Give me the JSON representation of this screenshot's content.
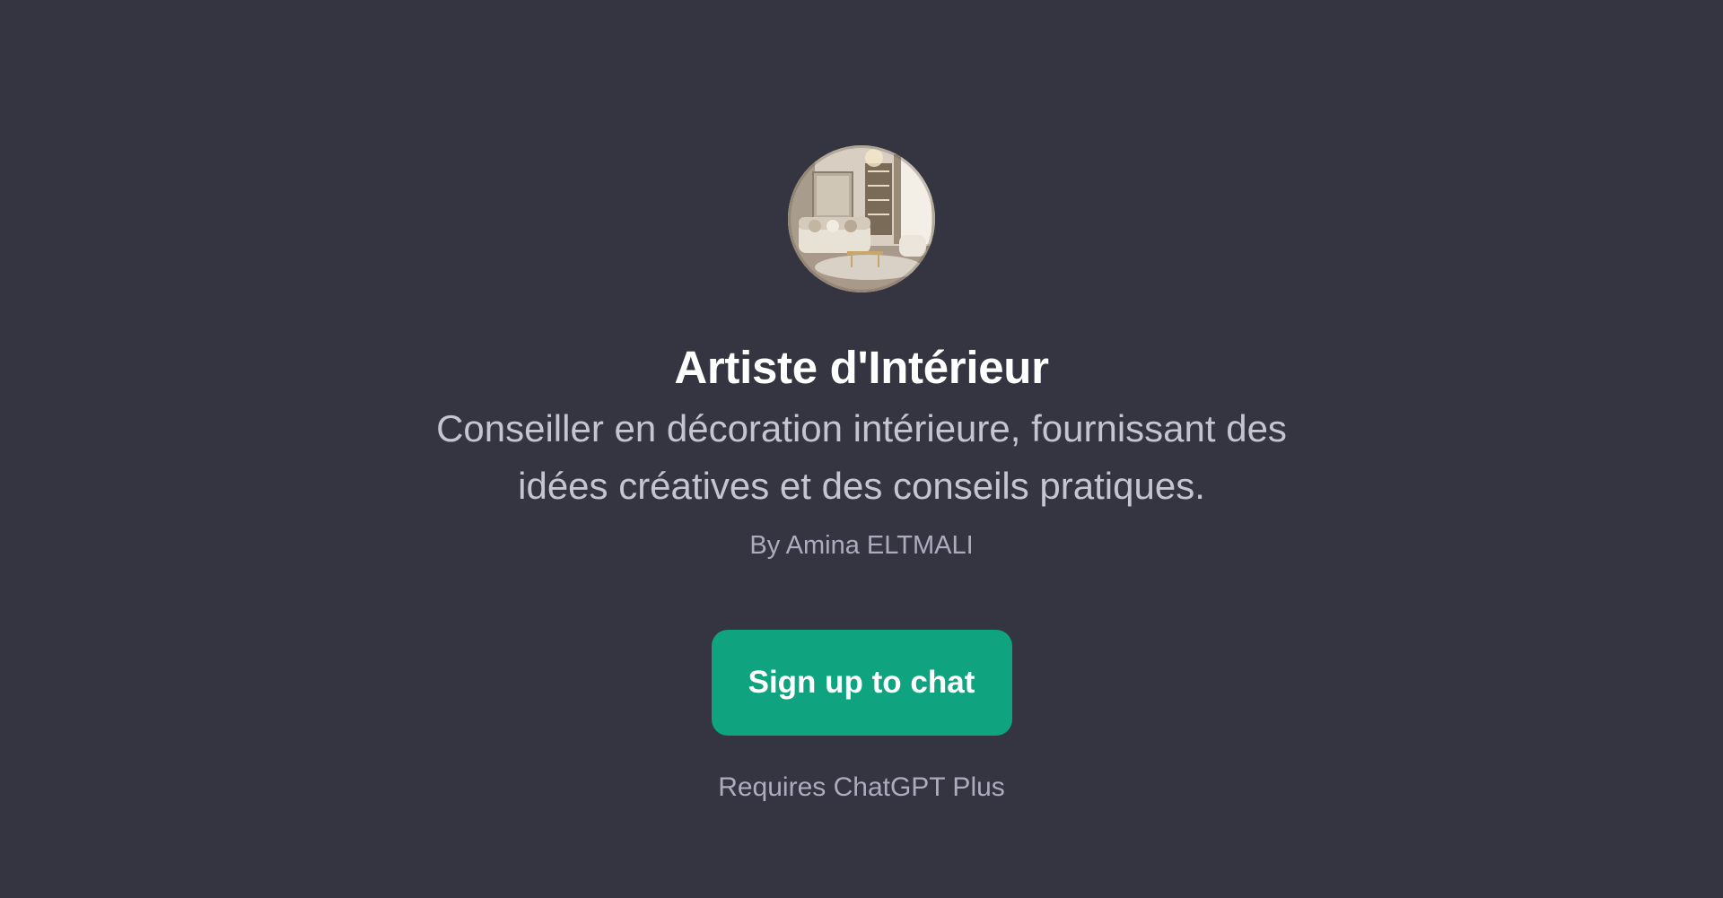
{
  "gpt": {
    "name": "Artiste d'Intérieur",
    "description": "Conseiller en décoration intérieure, fournissant des idées créatives et des conseils pratiques.",
    "author": "By Amina ELTMALI",
    "avatar_icon": "interior-living-room-image"
  },
  "actions": {
    "signup_label": "Sign up to chat"
  },
  "footer": {
    "requires": "Requires ChatGPT Plus"
  },
  "colors": {
    "background": "#343541",
    "accent": "#10a37f"
  }
}
